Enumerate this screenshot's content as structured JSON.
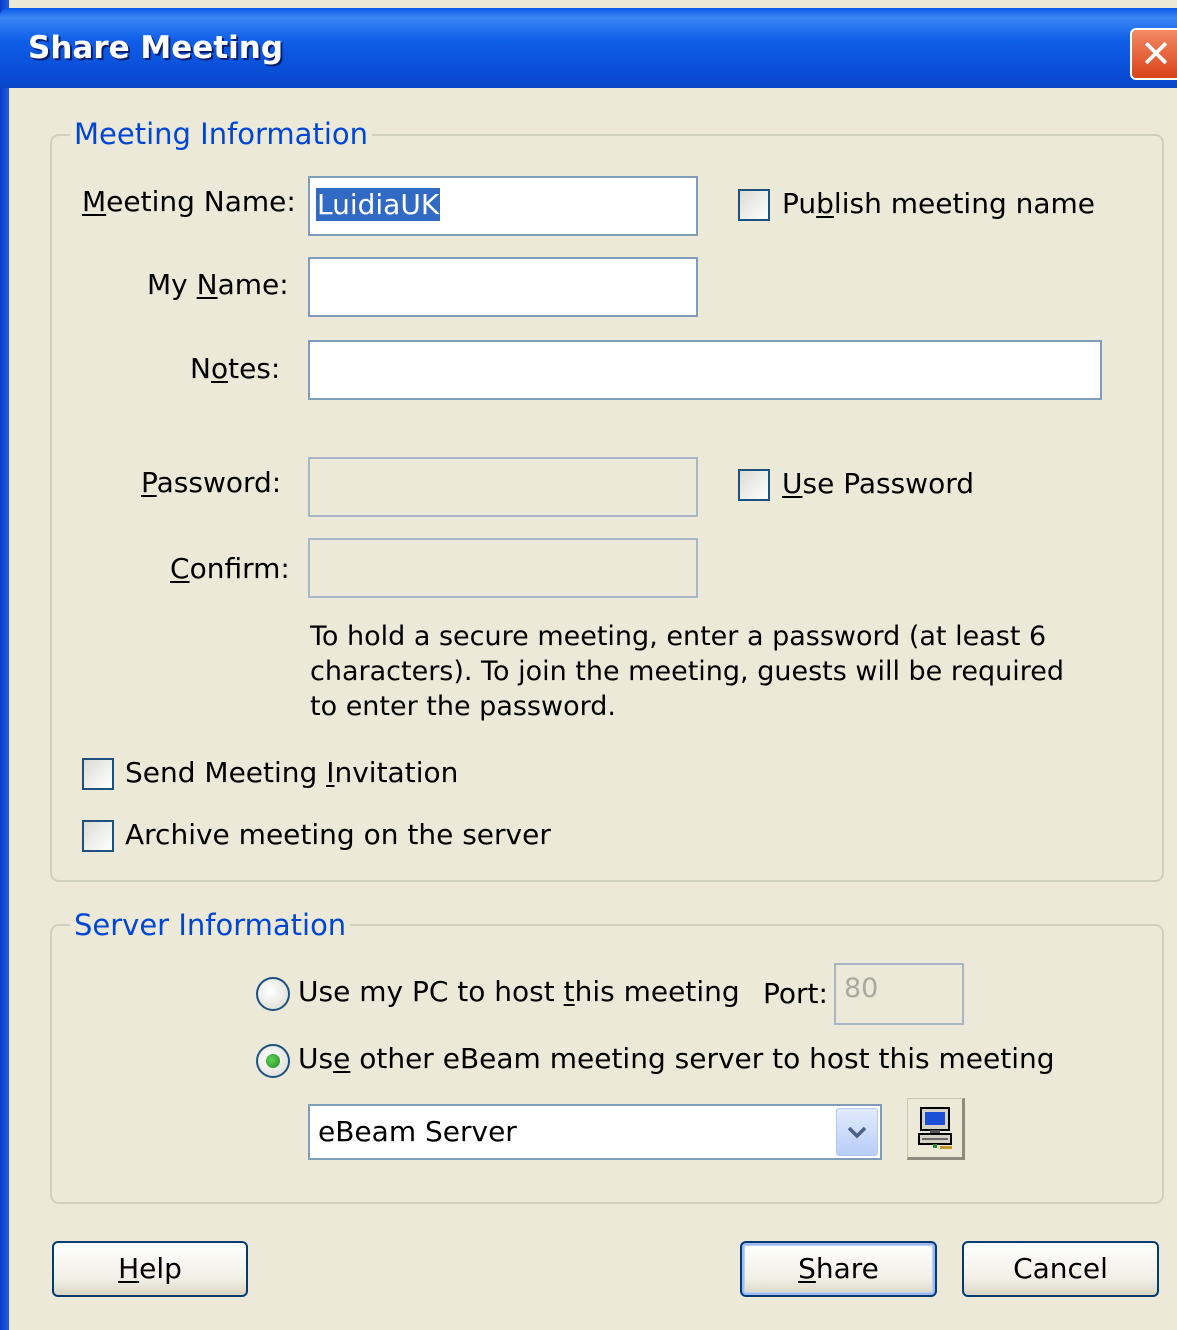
{
  "window": {
    "title": "Share Meeting",
    "close_glyph": "✕"
  },
  "meeting_info": {
    "legend": "Meeting Information",
    "meeting_name": {
      "label_pre": "",
      "label_key": "M",
      "label_post": "eeting Name:",
      "value": "LuidiaUK"
    },
    "publish": {
      "label_pre": "Pu",
      "label_key": "b",
      "label_post": "lish meeting name",
      "checked": false
    },
    "my_name": {
      "label_pre": "My ",
      "label_key": "N",
      "label_post": "ame:",
      "value": ""
    },
    "notes": {
      "label_pre": "N",
      "label_key": "o",
      "label_post": "tes:",
      "value": ""
    },
    "password": {
      "label_pre": "",
      "label_key": "P",
      "label_post": "assword:",
      "value": ""
    },
    "use_password": {
      "label_pre": "",
      "label_key": "U",
      "label_post": "se Password",
      "checked": false
    },
    "confirm": {
      "label_pre": "",
      "label_key": "C",
      "label_post": "onfirm:",
      "value": ""
    },
    "help_text": "To hold a secure meeting, enter a password (at least 6 characters). To join the meeting, guests will be required to enter the password.",
    "send_invitation": {
      "label_pre": "Send Meeting ",
      "label_key": "I",
      "label_post": "nvitation",
      "checked": false
    },
    "archive": {
      "label": "Archive meeting on the server",
      "checked": false
    }
  },
  "server_info": {
    "legend": "Server Information",
    "use_my_pc": {
      "label_pre": "Use my PC to host ",
      "label_key": "t",
      "label_post": "his meeting",
      "selected": false
    },
    "port": {
      "label": "Port:",
      "value": "80"
    },
    "use_other_server": {
      "label_pre": "Us",
      "label_key": "e",
      "label_post": " other eBeam meeting server to host this meeting",
      "selected": true
    },
    "server_select": {
      "value": "eBeam Server"
    },
    "server_button_icon": "computer-icon"
  },
  "buttons": {
    "help": {
      "pre": "",
      "key": "H",
      "post": "elp"
    },
    "share": {
      "pre": "",
      "key": "S",
      "post": "hare"
    },
    "cancel": {
      "label": "Cancel"
    }
  },
  "colors": {
    "titlebar": "#0a4fd9",
    "dialog_bg": "#ece9d8",
    "legend_text": "#0046d5",
    "close_button": "#d9431a",
    "selection": "#316ac5"
  }
}
